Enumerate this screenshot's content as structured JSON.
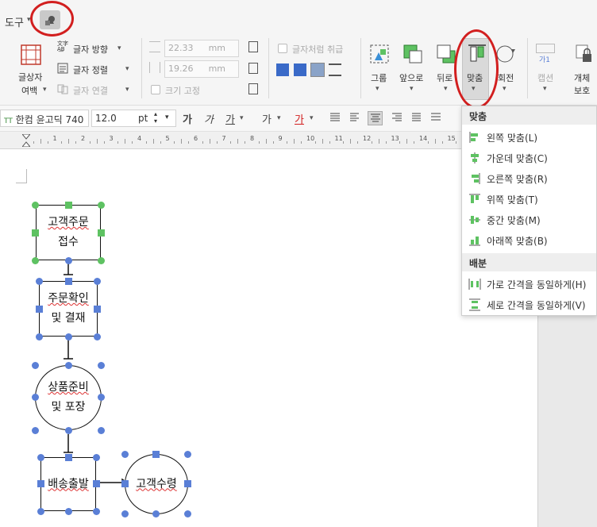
{
  "toolbar": {
    "menu_label": "도구",
    "margin_group_label": "글상자",
    "margin_label": "여백",
    "text_direction": "글자 방향",
    "text_align": "글자 정렬",
    "text_link": "글자 연결",
    "width_value": "22.33",
    "height_value": "19.26",
    "unit_mm": "mm",
    "treat_as_char": "글자처럼 취급",
    "size_fixed": "크기 고정",
    "group": "그룹",
    "bring_front": "앞으로",
    "send_back": "뒤로",
    "align": "맞춤",
    "rotate": "회전",
    "caption": "캡션",
    "caption_sample": "가1",
    "protect_line1": "개체",
    "protect_line2": "보호"
  },
  "format_bar": {
    "font_name": "한컴 윤고딕 740",
    "font_size": "12.0",
    "font_unit": "pt",
    "bold": "가",
    "italic": "가",
    "underline": "가",
    "strike": "가",
    "color": "가"
  },
  "ruler": {
    "ticks": [
      "1",
      "2",
      "3",
      "4",
      "5",
      "6",
      "7",
      "8",
      "9",
      "10",
      "11",
      "12",
      "13",
      "14",
      "15"
    ]
  },
  "dropdown": {
    "section_align": "맞춤",
    "items_align": [
      "왼쪽 맞춤(L)",
      "가운데 맞춤(C)",
      "오른쪽 맞춤(R)",
      "위쪽 맞춤(T)",
      "중간 맞춤(M)",
      "아래쪽 맞춤(B)"
    ],
    "section_distribute": "배분",
    "items_distribute": [
      "가로 간격을 동일하게(H)",
      "세로 간격을 동일하게(V)"
    ]
  },
  "flowchart": {
    "node1_line1": "고객주문",
    "node1_line2": "접수",
    "node2_line1": "주문확인",
    "node2_line2": "및 결재",
    "node3_line1": "상품준비",
    "node3_line2": "및 포장",
    "node4": "배송출발",
    "node5": "고객수령"
  },
  "colors": {
    "accent_green": "#5ec262",
    "handle_blue": "#5a7fd6",
    "annotation_red": "#d21f1f"
  }
}
